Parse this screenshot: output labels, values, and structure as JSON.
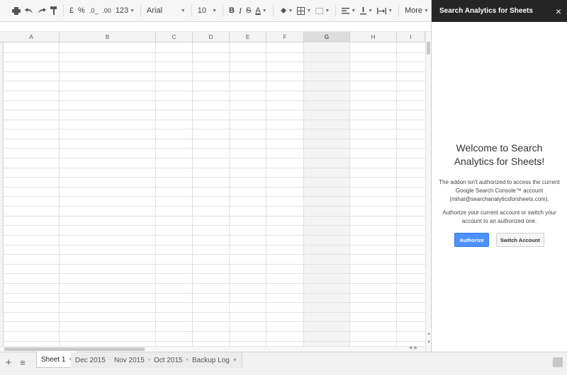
{
  "toolbar": {
    "currency": "£",
    "percent": "%",
    "dec_decrease": ".0_",
    "dec_increase": ".00",
    "number_format": "123",
    "font": "Arial",
    "font_size": "10",
    "bold": "B",
    "italic": "I",
    "strike": "S",
    "text_color": "A",
    "more": "More"
  },
  "columns": [
    "A",
    "B",
    "C",
    "D",
    "E",
    "F",
    "G",
    "H",
    "I"
  ],
  "selected_column": "G",
  "sheet_tabs": [
    {
      "label": "Sheet 1",
      "active": true
    },
    {
      "label": "Dec 2015",
      "active": false
    },
    {
      "label": "Nov 2015",
      "active": false
    },
    {
      "label": "Oct 2015",
      "active": false
    },
    {
      "label": "Backup Log",
      "active": false
    }
  ],
  "sidebar": {
    "title": "Search Analytics for Sheets",
    "close": "×",
    "welcome": "Welcome to Search Analytics for Sheets!",
    "message": "The addon isn't authorized to access the current Google Search Console™ account (mihai@searchanalyticsforsheets.com).",
    "instruction": "Authorize your current account or switch your account to an authorized one.",
    "authorize_label": "Authorize",
    "switch_label": "Switch Account",
    "accent_color": "#4d90fe"
  }
}
